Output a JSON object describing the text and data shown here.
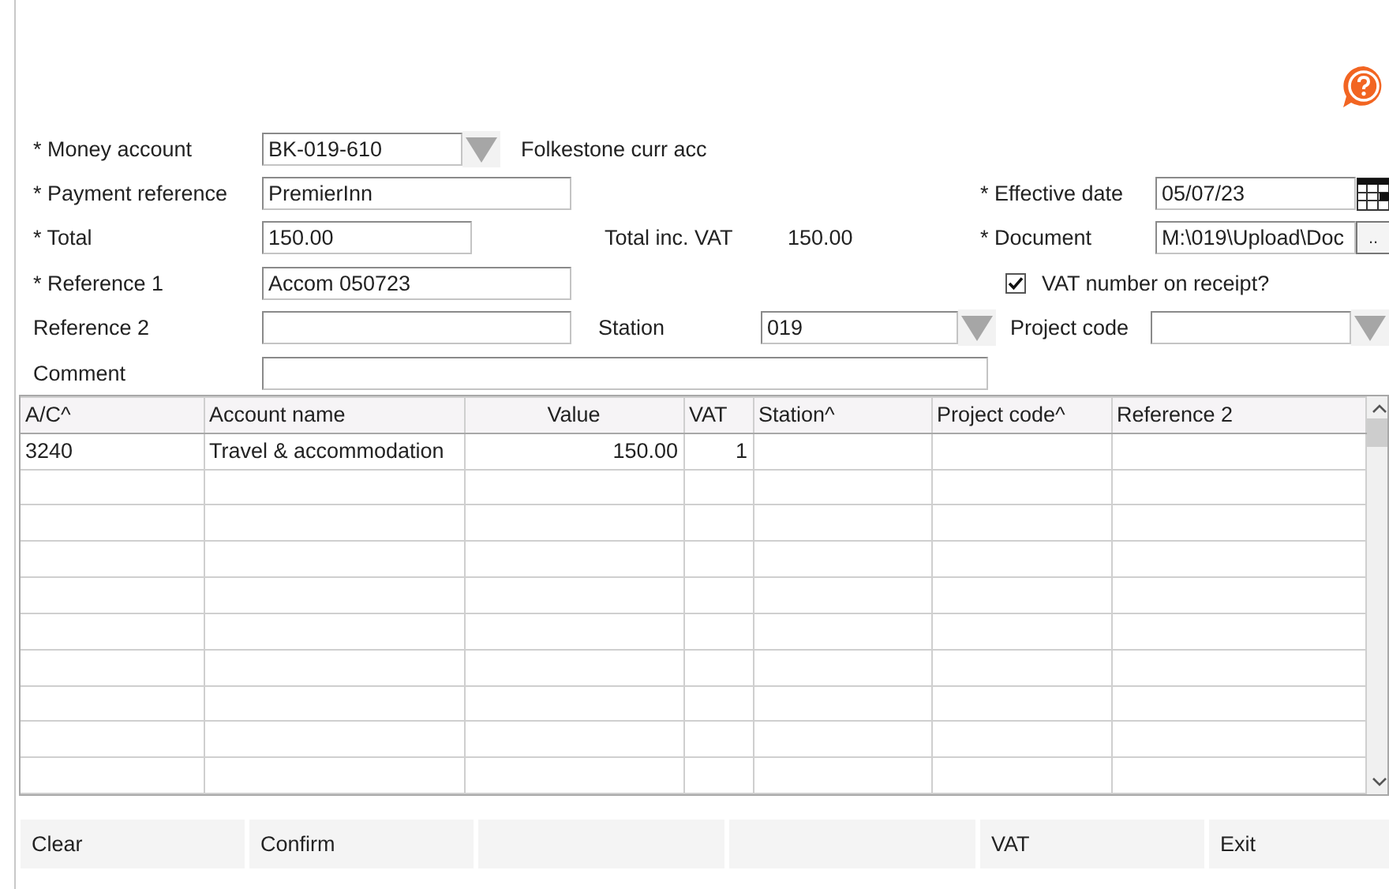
{
  "form": {
    "money_account": {
      "label": "* Money account",
      "value": "BK-019-610",
      "description": "Folkestone curr acc"
    },
    "payment_reference": {
      "label": "* Payment reference",
      "value": "PremierInn"
    },
    "effective_date": {
      "label": "* Effective date",
      "value": "05/07/23"
    },
    "total": {
      "label": "* Total",
      "value": "150.00"
    },
    "total_inc_vat": {
      "label": "Total inc. VAT",
      "value": "150.00"
    },
    "document": {
      "label": "* Document",
      "value": "M:\\019\\Upload\\Doc",
      "browse_button": ".."
    },
    "reference_1": {
      "label": "* Reference 1",
      "value": "Accom 050723"
    },
    "vat_number_on_receipt": {
      "label": "VAT number on receipt?",
      "checked": true
    },
    "reference_2": {
      "label": "Reference 2"
    },
    "station": {
      "label": "Station",
      "value": "019"
    },
    "project_code": {
      "label": "Project code"
    },
    "comment": {
      "label": "Comment"
    }
  },
  "table": {
    "columns": [
      "A/C^",
      "Account name",
      "Value",
      "VAT",
      "Station^",
      "Project code^",
      "Reference 2"
    ],
    "rows": [
      [
        "3240",
        "Travel & accommodation",
        "150.00",
        "1",
        "",
        "",
        ""
      ]
    ]
  },
  "buttons": [
    {
      "kind": "button",
      "label": "Clear"
    },
    {
      "kind": "button",
      "label": "Confirm"
    },
    {
      "kind": "blank"
    },
    {
      "kind": "blank"
    },
    {
      "kind": "button",
      "label": "VAT"
    },
    {
      "kind": "button",
      "label": "Exit"
    }
  ]
}
